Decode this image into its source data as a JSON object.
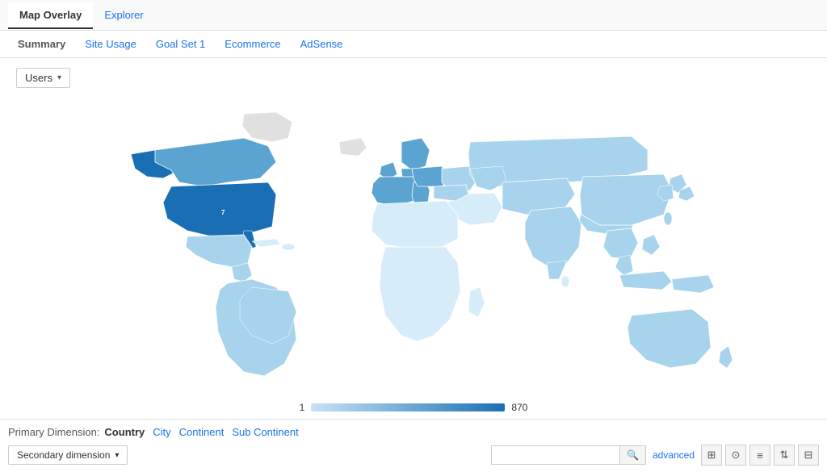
{
  "tabs": [
    {
      "id": "map-overlay",
      "label": "Map Overlay",
      "active": true,
      "blue": false
    },
    {
      "id": "explorer",
      "label": "Explorer",
      "active": false,
      "blue": true
    }
  ],
  "subtabs": [
    {
      "id": "summary",
      "label": "Summary",
      "active": true
    },
    {
      "id": "site-usage",
      "label": "Site Usage",
      "active": false
    },
    {
      "id": "goal-set-1",
      "label": "Goal Set 1",
      "active": false
    },
    {
      "id": "ecommerce",
      "label": "Ecommerce",
      "active": false
    },
    {
      "id": "adsense",
      "label": "AdSense",
      "active": false
    }
  ],
  "dropdown": {
    "label": "Users",
    "arrow": "▾"
  },
  "legend": {
    "min": "1",
    "max": "870"
  },
  "primary_dimension": {
    "label": "Primary Dimension:",
    "active": "Country",
    "links": [
      "City",
      "Continent",
      "Sub Continent"
    ]
  },
  "secondary_dimension": {
    "label": "Secondary dimension",
    "arrow": "▾"
  },
  "search": {
    "placeholder": "",
    "search_icon": "🔍",
    "advanced_label": "advanced"
  },
  "view_icons": [
    "⊞",
    "🌐",
    "≡",
    "↕",
    "⊟"
  ],
  "colors": {
    "dark_blue": "#1a6fb4",
    "mid_blue": "#5ba3d0",
    "light_blue": "#a8d3ec",
    "very_light_blue": "#d6ecf8",
    "gray": "#e0e0e0",
    "white": "#ffffff",
    "accent_blue": "#1a73e8"
  }
}
